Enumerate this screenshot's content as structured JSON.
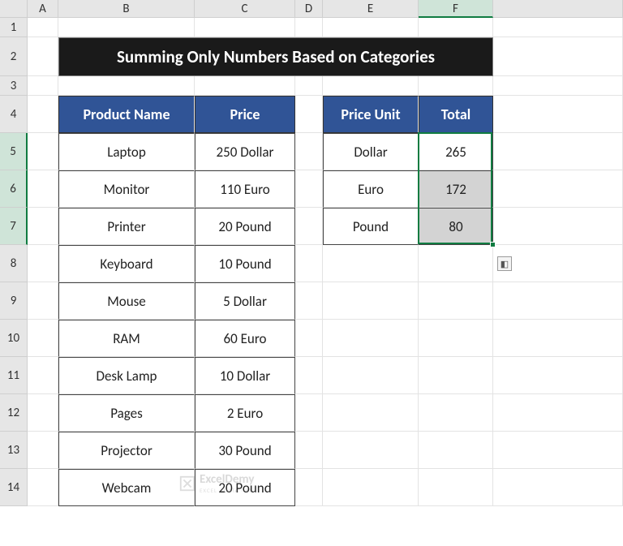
{
  "columns": [
    "A",
    "B",
    "C",
    "D",
    "E",
    "F"
  ],
  "rows": [
    "1",
    "2",
    "3",
    "4",
    "5",
    "6",
    "7",
    "8",
    "9",
    "10",
    "11",
    "12",
    "13",
    "14"
  ],
  "title": "Summing Only Numbers Based on Categories",
  "table1": {
    "headers": [
      "Product Name",
      "Price"
    ],
    "rows": [
      [
        "Laptop",
        "250 Dollar"
      ],
      [
        "Monitor",
        "110 Euro"
      ],
      [
        "Printer",
        "20 Pound"
      ],
      [
        "Keyboard",
        "10 Pound"
      ],
      [
        "Mouse",
        "5 Dollar"
      ],
      [
        "RAM",
        "60 Euro"
      ],
      [
        "Desk Lamp",
        "10 Dollar"
      ],
      [
        "Pages",
        "2 Euro"
      ],
      [
        "Projector",
        "30 Pound"
      ],
      [
        "Webcam",
        "20 Pound"
      ]
    ]
  },
  "table2": {
    "headers": [
      "Price Unit",
      "Total"
    ],
    "rows": [
      [
        "Dollar",
        "265"
      ],
      [
        "Euro",
        "172"
      ],
      [
        "Pound",
        "80"
      ]
    ]
  },
  "selected_col": "F",
  "selected_rows": [
    "5",
    "6",
    "7"
  ],
  "watermark": {
    "name": "ExcelDemy",
    "sub": "EXCEL · DATA · BI"
  }
}
